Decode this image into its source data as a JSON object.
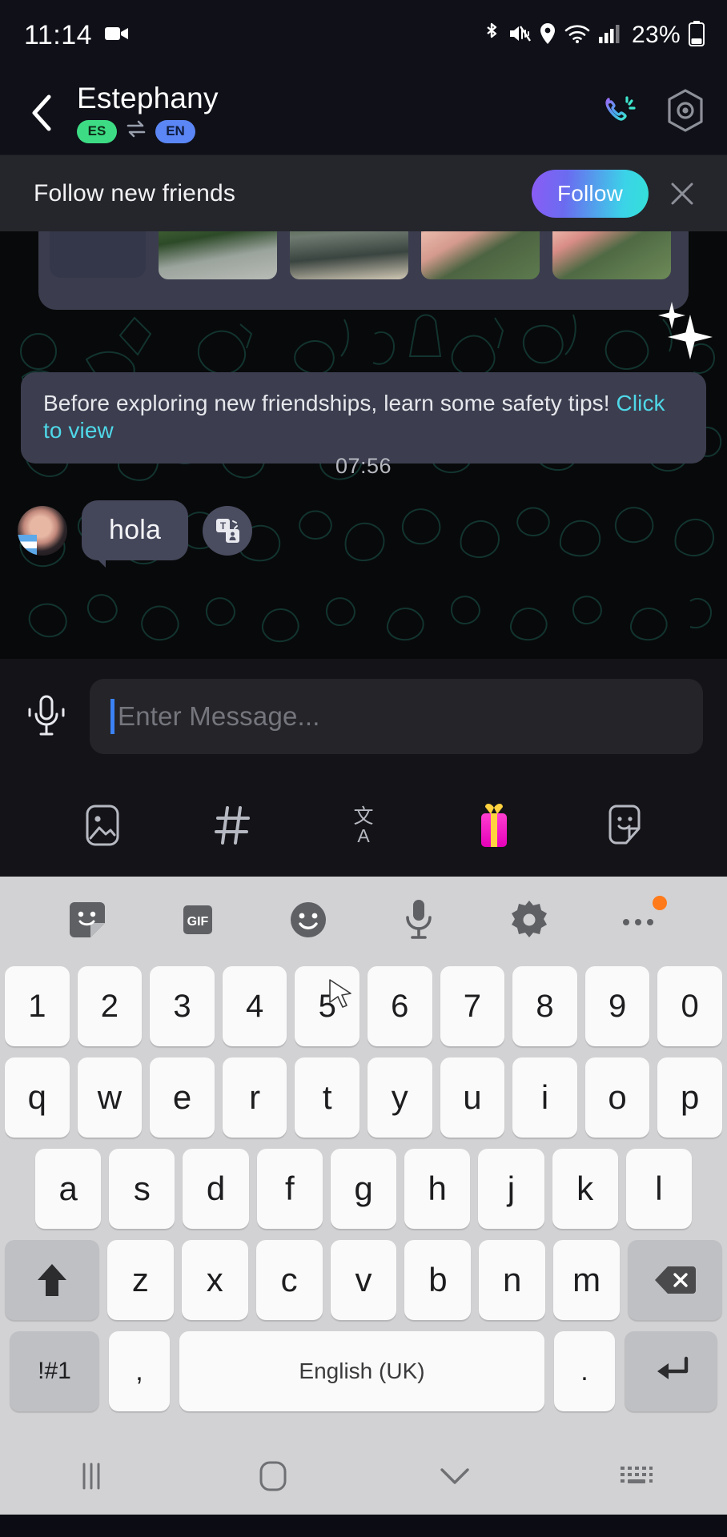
{
  "status_bar": {
    "time": "11:14",
    "battery_percent": "23%",
    "icons": [
      "video-camera-icon",
      "bluetooth-icon",
      "mute-icon",
      "location-icon",
      "wifi-icon",
      "signal-icon",
      "battery-icon"
    ]
  },
  "header": {
    "back_icon": "back-chevron-icon",
    "contact_name": "Estephany",
    "lang_from": "ES",
    "lang_to": "EN",
    "swap_icon": "swap-arrows-icon",
    "call_icon": "phone-call-icon",
    "settings_icon": "hex-settings-icon"
  },
  "follow_banner": {
    "text": "Follow new friends",
    "button_label": "Follow",
    "close_icon": "close-icon",
    "gradient_from": "#8b5cf6",
    "gradient_to": "#34e0d8"
  },
  "chat": {
    "safety_text": "Before exploring new friendships, learn some safety tips! ",
    "safety_link": "Click to view",
    "link_color": "#4fd8e8",
    "timestamp": "07:56",
    "message": {
      "sender": "Estephany",
      "text": "hola",
      "translate_icon": "translate-icon",
      "avatar_icon": "avatar"
    },
    "photo_card": {
      "thumbnail_count": 4
    },
    "sparkle_icon": "sparkle-icon"
  },
  "input_bar": {
    "mic_icon": "microphone-icon",
    "placeholder": "Enter Message...",
    "value": ""
  },
  "action_bar": {
    "items": [
      {
        "name": "gallery-icon",
        "label": "Gallery"
      },
      {
        "name": "hashtag-icon",
        "label": "Hashtag"
      },
      {
        "name": "translate-icon",
        "label": "Translate"
      },
      {
        "name": "gift-icon",
        "label": "Gift"
      },
      {
        "name": "sticker-icon",
        "label": "Sticker"
      }
    ]
  },
  "keyboard": {
    "toolbar": [
      {
        "name": "sticker-icon",
        "label": "Sticker"
      },
      {
        "name": "gif-icon",
        "label": "GIF"
      },
      {
        "name": "emoji-icon",
        "label": "Emoji"
      },
      {
        "name": "mic-icon",
        "label": "Voice"
      },
      {
        "name": "settings-gear-icon",
        "label": "Settings"
      },
      {
        "name": "more-options-icon",
        "label": "More"
      }
    ],
    "gif_label": "GIF",
    "row_numbers": [
      "1",
      "2",
      "3",
      "4",
      "5",
      "6",
      "7",
      "8",
      "9",
      "0"
    ],
    "row_top": [
      "q",
      "w",
      "e",
      "r",
      "t",
      "y",
      "u",
      "i",
      "o",
      "p"
    ],
    "row_home": [
      "a",
      "s",
      "d",
      "f",
      "g",
      "h",
      "j",
      "k",
      "l"
    ],
    "row_bottom": [
      "z",
      "x",
      "c",
      "v",
      "b",
      "n",
      "m"
    ],
    "shift_icon": "shift-icon",
    "backspace_icon": "backspace-icon",
    "symbols_label": "!#1",
    "comma_label": ",",
    "space_label": "English (UK)",
    "period_label": ".",
    "enter_icon": "enter-icon"
  },
  "nav_bar": {
    "recents_icon": "recents-icon",
    "home_icon": "home-icon",
    "hide_keyboard_icon": "chevron-down-icon",
    "keyboard_switch_icon": "keyboard-switch-icon"
  }
}
